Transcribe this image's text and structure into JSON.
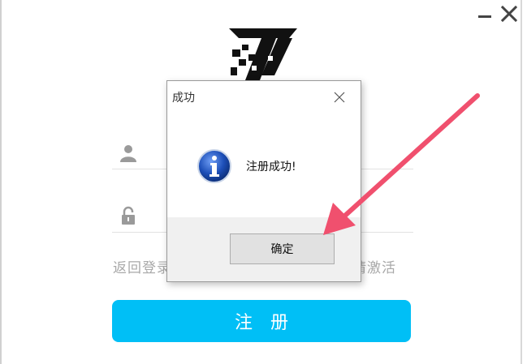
{
  "window": {
    "minimize_glyph": "—",
    "close_glyph": "✕"
  },
  "form": {
    "username_placeholder": "",
    "password_placeholder": ""
  },
  "links": {
    "back_to_login": "返回登录",
    "activate": "请激活"
  },
  "register_button": {
    "label": "注册"
  },
  "dialog": {
    "title": "成功",
    "message": "注册成功!",
    "ok_label": "确定"
  },
  "colors": {
    "accent": "#00bff6",
    "arrow": "#f0506e",
    "info_blue": "#1d4fb8"
  },
  "icons": [
    "minimize-icon",
    "close-icon",
    "logo",
    "user-icon",
    "lock-icon",
    "info-icon",
    "dialog-close-icon",
    "arrow-annotation"
  ]
}
